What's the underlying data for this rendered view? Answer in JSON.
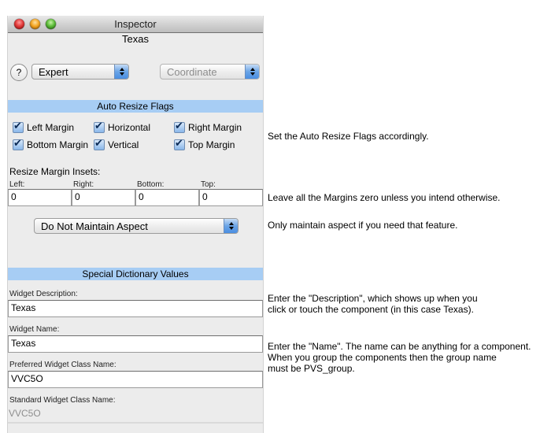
{
  "window": {
    "title": "Inspector",
    "subtitle": "Texas",
    "traffic_lights": [
      "close",
      "minimize",
      "zoom"
    ]
  },
  "toolbar": {
    "help_label": "?",
    "mode_popup": {
      "value": "Expert"
    },
    "coordinate_popup": {
      "value": "Coordinate",
      "enabled": false
    }
  },
  "auto_resize": {
    "header": "Auto Resize Flags",
    "flags": [
      {
        "label": "Left Margin",
        "checked": true
      },
      {
        "label": "Horizontal",
        "checked": true
      },
      {
        "label": "Right Margin",
        "checked": true
      },
      {
        "label": "Bottom Margin",
        "checked": true
      },
      {
        "label": "Vertical",
        "checked": true
      },
      {
        "label": "Top Margin",
        "checked": true
      }
    ]
  },
  "insets": {
    "title": "Resize Margin Insets:",
    "fields": [
      {
        "label": "Left:",
        "value": "0"
      },
      {
        "label": "Right:",
        "value": "0"
      },
      {
        "label": "Bottom:",
        "value": "0"
      },
      {
        "label": "Top:",
        "value": "0"
      }
    ]
  },
  "aspect_popup": {
    "value": "Do Not Maintain Aspect"
  },
  "dictionary": {
    "header": "Special Dictionary Values",
    "fields": [
      {
        "label": "Widget Description:",
        "value": "Texas",
        "editable": true
      },
      {
        "label": "Widget Name:",
        "value": "Texas",
        "editable": true
      },
      {
        "label": "Preferred Widget Class Name:",
        "value": "VVC5O",
        "editable": true
      },
      {
        "label": "Standard Widget Class Name:",
        "value": "VVC5O",
        "editable": false
      }
    ]
  },
  "notes": {
    "auto_resize": "Set the Auto Resize Flags accordingly.",
    "margins": "Leave all the Margins zero unless you intend otherwise.",
    "aspect": "Only maintain aspect if you need that feature.",
    "description": "Enter the \"Description\", which shows up when you\nclick or touch the component (in this case Texas).",
    "name": "Enter the \"Name\". The name can be anything for a component.\nWhen you group the components then the group name\nmust be PVS_group."
  },
  "colors": {
    "section_header": "#a7cdf4",
    "window_bg": "#ececec",
    "popup_arrow": "#4a8ee2"
  }
}
